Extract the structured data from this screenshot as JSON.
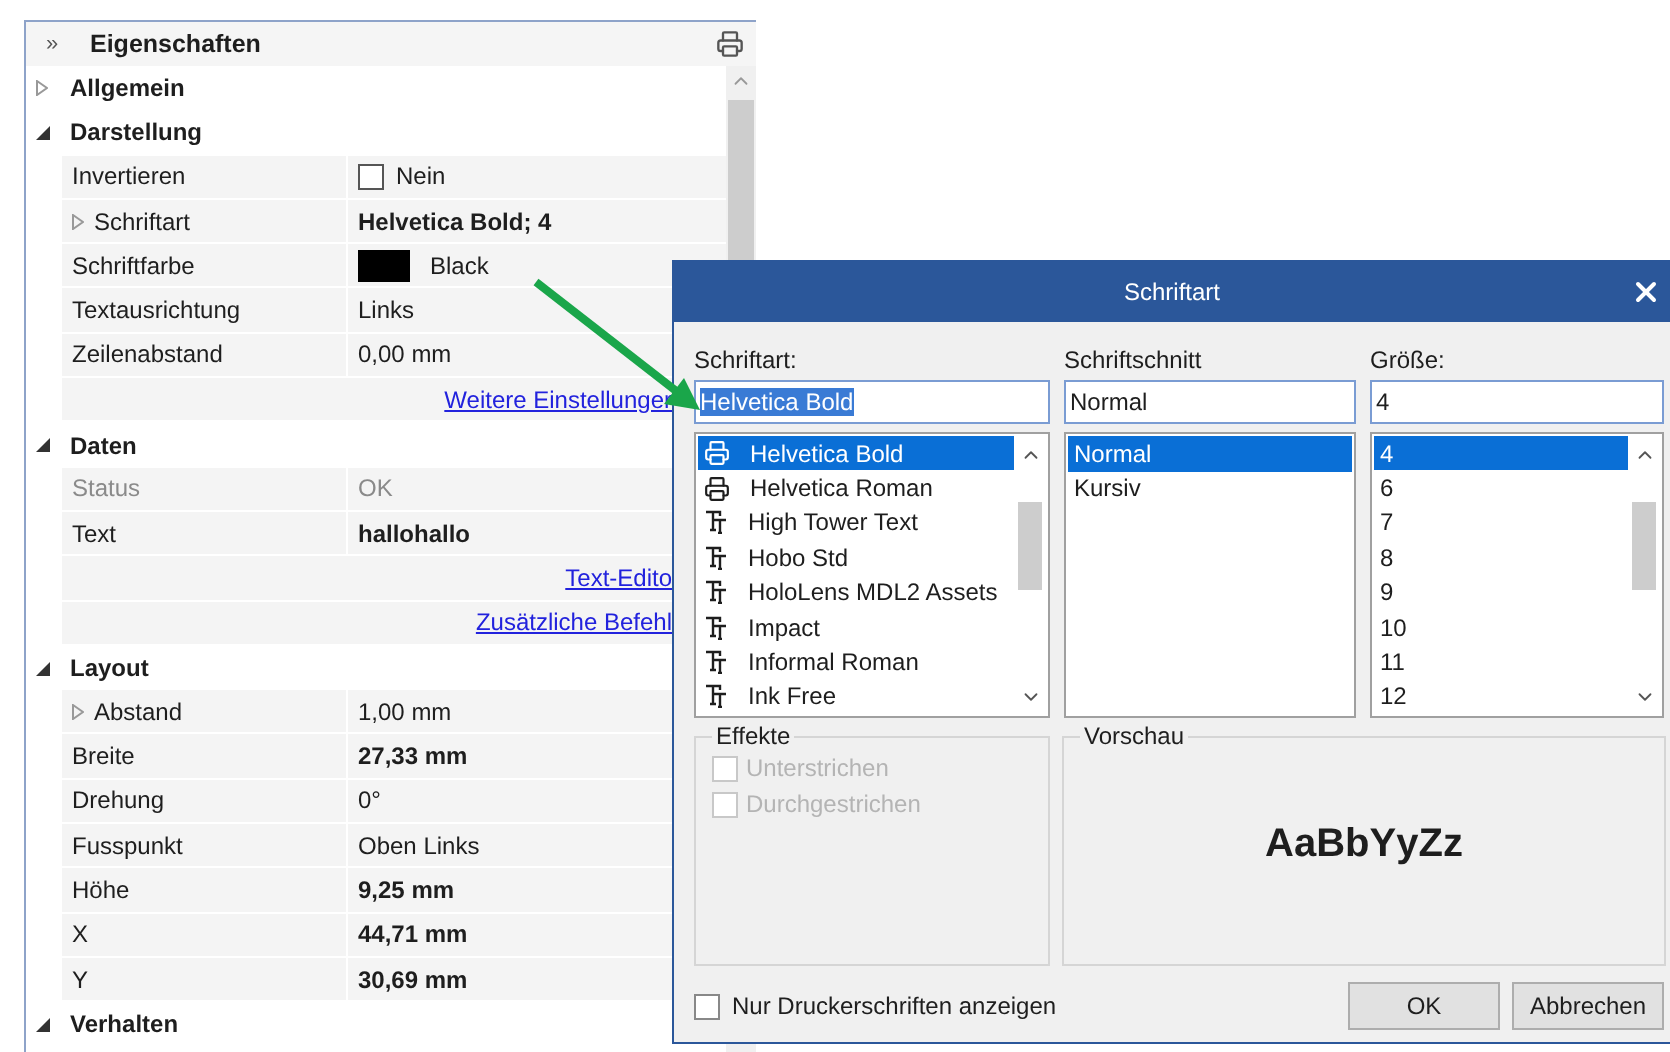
{
  "panel": {
    "collapse": "»",
    "title": "Eigenschaften",
    "sections": [
      {
        "label": "Allgemein",
        "expanded": false
      },
      {
        "label": "Darstellung",
        "expanded": true,
        "rows": [
          {
            "kind": "checkbox",
            "label": "Invertieren",
            "value": "Nein",
            "checked": false
          },
          {
            "kind": "group",
            "label": "Schriftart",
            "value": "Helvetica Bold; 4",
            "bold": true,
            "expanded": false
          },
          {
            "kind": "color",
            "label": "Schriftfarbe",
            "value": "Black",
            "color": "#000000"
          },
          {
            "kind": "text",
            "label": "Textausrichtung",
            "value": "Links"
          },
          {
            "kind": "text",
            "label": "Zeilenabstand",
            "value": "0,00 mm"
          },
          {
            "kind": "link",
            "value": "Weitere Einstellunger"
          }
        ]
      },
      {
        "label": "Daten",
        "expanded": true,
        "rows": [
          {
            "kind": "text",
            "label": "Status",
            "value": "OK",
            "disabled": true
          },
          {
            "kind": "text",
            "label": "Text",
            "value": "hallohallo",
            "bold": true
          },
          {
            "kind": "link",
            "value": "Text-Edito"
          },
          {
            "kind": "link",
            "value": "Zusätzliche Befehl"
          }
        ]
      },
      {
        "label": "Layout",
        "expanded": true,
        "rows": [
          {
            "kind": "group",
            "label": "Abstand",
            "value": "1,00 mm",
            "expanded": false
          },
          {
            "kind": "text",
            "label": "Breite",
            "value": "27,33 mm",
            "bold": true
          },
          {
            "kind": "text",
            "label": "Drehung",
            "value": "0°"
          },
          {
            "kind": "text",
            "label": "Fusspunkt",
            "value": "Oben Links"
          },
          {
            "kind": "text",
            "label": "Höhe",
            "value": "9,25 mm",
            "bold": true
          },
          {
            "kind": "text",
            "label": "X",
            "value": "44,71 mm",
            "bold": true
          },
          {
            "kind": "text",
            "label": "Y",
            "value": "30,69 mm",
            "bold": true
          }
        ]
      },
      {
        "label": "Verhalten",
        "expanded": true
      }
    ]
  },
  "dialog": {
    "title": "Schriftart",
    "columns": [
      {
        "label": "Schriftart:",
        "value": "Helvetica Bold",
        "value_selected": true,
        "scrollable": true,
        "items": [
          {
            "text": "Helvetica Bold",
            "kind": "printer",
            "selected": true
          },
          {
            "text": "Helvetica Roman",
            "kind": "printer",
            "selected": false
          },
          {
            "text": "High Tower Text",
            "kind": "truetype",
            "selected": false
          },
          {
            "text": "Hobo Std",
            "kind": "truetype",
            "selected": false
          },
          {
            "text": "HoloLens MDL2 Assets",
            "kind": "truetype",
            "selected": false
          },
          {
            "text": "Impact",
            "kind": "truetype",
            "selected": false
          },
          {
            "text": "Informal Roman",
            "kind": "truetype",
            "selected": false
          },
          {
            "text": "Ink Free",
            "kind": "truetype",
            "selected": false
          }
        ]
      },
      {
        "label": "Schriftschnitt",
        "value": "Normal",
        "value_selected": false,
        "scrollable": false,
        "items": [
          {
            "text": "Normal",
            "selected": true
          },
          {
            "text": "Kursiv",
            "selected": false
          }
        ]
      },
      {
        "label": "Größe:",
        "value": "4",
        "value_selected": false,
        "scrollable": true,
        "items": [
          {
            "text": "4",
            "selected": true
          },
          {
            "text": "6",
            "selected": false
          },
          {
            "text": "7",
            "selected": false
          },
          {
            "text": "8",
            "selected": false
          },
          {
            "text": "9",
            "selected": false
          },
          {
            "text": "10",
            "selected": false
          },
          {
            "text": "11",
            "selected": false
          },
          {
            "text": "12",
            "selected": false
          }
        ]
      }
    ],
    "effects": {
      "label": "Effekte",
      "options": [
        {
          "label": "Unterstrichen",
          "checked": false,
          "disabled": true
        },
        {
          "label": "Durchgestrichen",
          "checked": false,
          "disabled": true
        }
      ]
    },
    "preview": {
      "label": "Vorschau",
      "sample": "AaBbYyZz"
    },
    "printer_only": {
      "label": "Nur Druckerschriften anzeigen",
      "checked": false
    },
    "buttons": [
      "OK",
      "Abbrechen"
    ]
  }
}
